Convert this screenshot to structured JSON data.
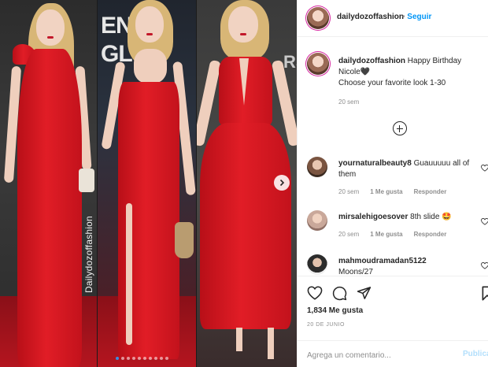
{
  "photos": {
    "backdrop_top": "EN",
    "backdrop_bottom": "GLO",
    "backdrop_right": "RS",
    "watermark": "Dailydozoffashion",
    "carousel": {
      "total": 10,
      "active": 1
    },
    "next_icon": "chevron-right-icon"
  },
  "header": {
    "username": "dailydozoffashion",
    "separator": "•",
    "follow_label": "Seguir"
  },
  "caption": {
    "username": "dailydozoffashion",
    "text_line1": "Happy Birthday Nicole🖤",
    "text_line2": "Choose your favorite look 1-30",
    "time": "20 sem"
  },
  "load_more_icon": "plus-circle-icon",
  "comments": [
    {
      "username": "yournaturalbeauty8",
      "text": "Guauuuuu all of them",
      "time": "20 sem",
      "likes": "1 Me gusta",
      "reply": "Responder"
    },
    {
      "username": "mirsalehigoesover",
      "text": "8th slide 🤩",
      "time": "20 sem",
      "likes": "1 Me gusta",
      "reply": "Responder"
    },
    {
      "username": "mahmoudramadan5122",
      "text": "Moons/27",
      "time": "",
      "likes": "",
      "reply": ""
    }
  ],
  "actions": {
    "likes": "1,834 Me gusta",
    "date": "20 DE JUNIO"
  },
  "add_comment": {
    "placeholder": "Agrega un comentario...",
    "publish_label": "Publicar"
  },
  "colors": {
    "accent": "#0095f6",
    "dress_red": "#d61a24",
    "muted": "#8e8e8e"
  }
}
